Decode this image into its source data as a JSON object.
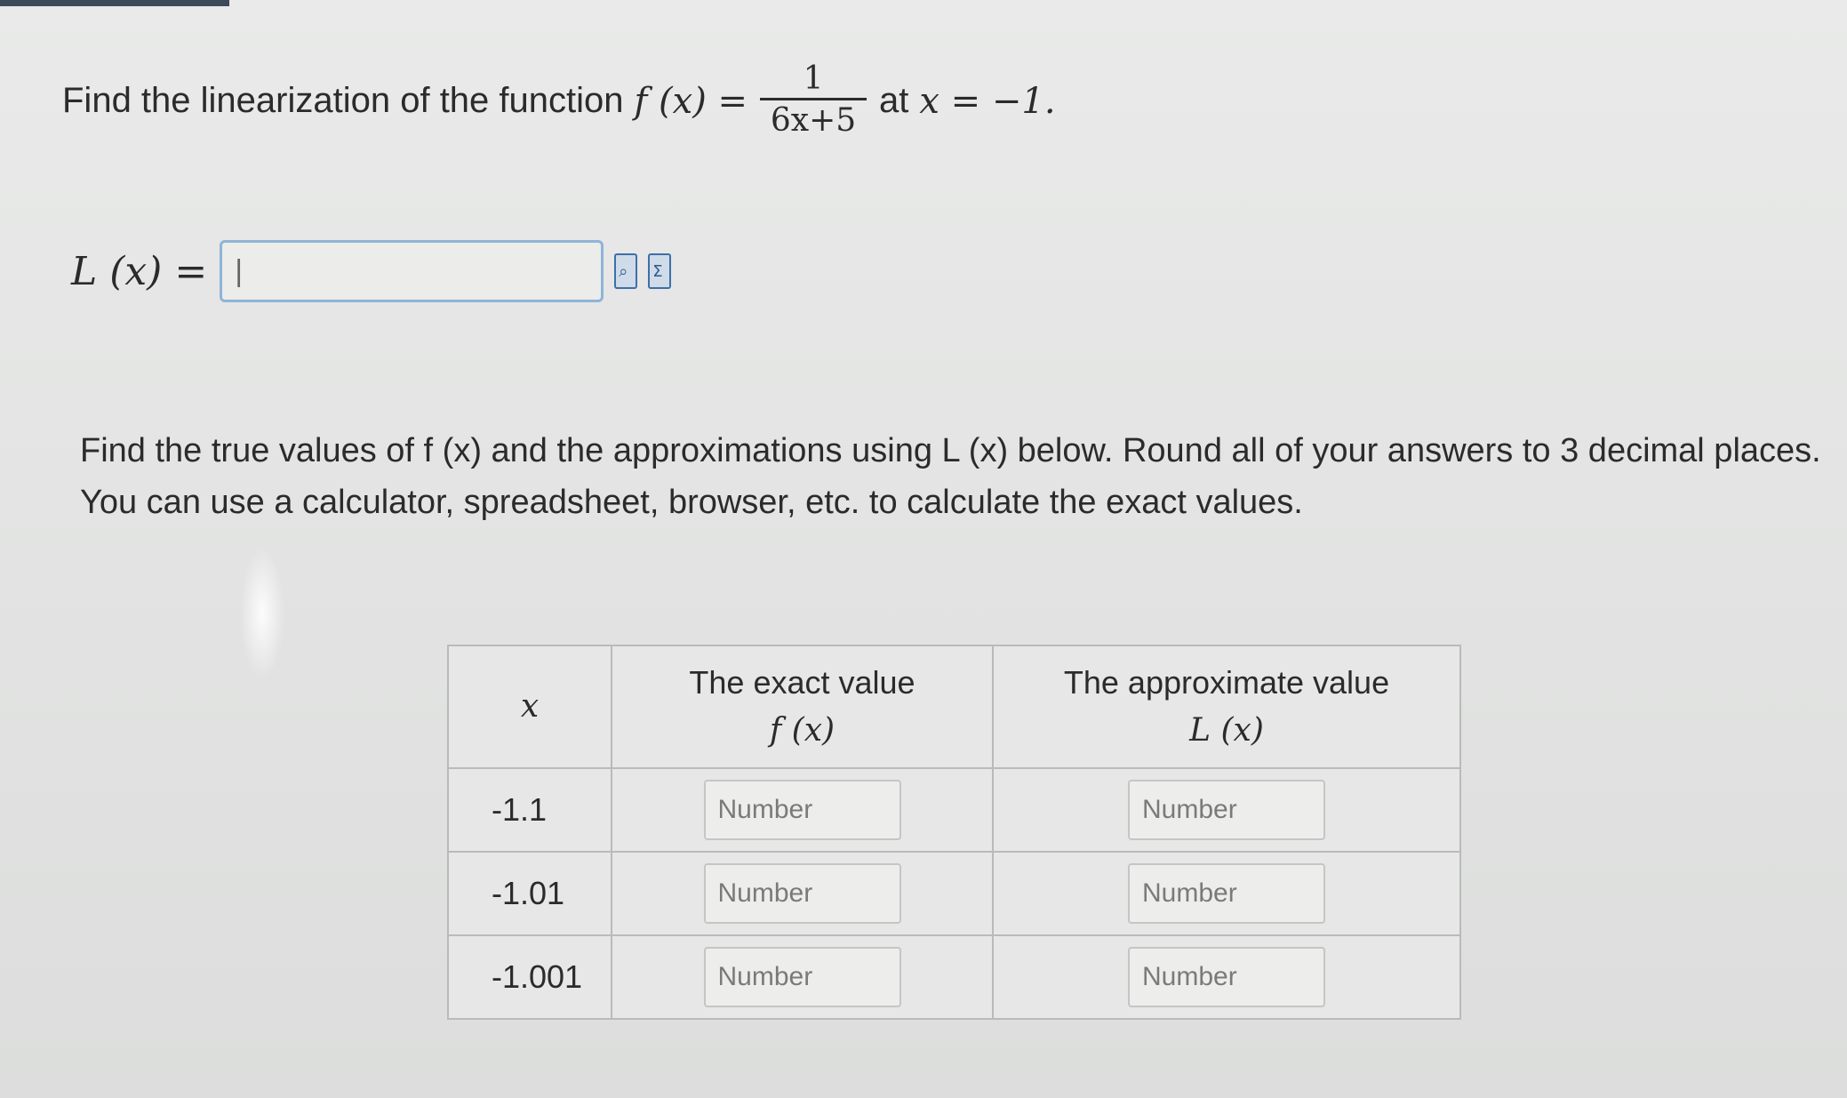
{
  "question": {
    "prefix": "Find the linearization of the function",
    "fx": "f (x) =",
    "numerator": "1",
    "denominator": "6x+5",
    "at": "at",
    "point": "x = −1."
  },
  "linearization": {
    "label": "L (x) =",
    "value": "|"
  },
  "instructions": "Find the true values of f (x) and the approximations using L (x) below. Round all of your answers to 3 decimal places. You can use a calculator, spreadsheet, browser, etc. to calculate the exact values.",
  "table": {
    "headers": [
      {
        "line1": "",
        "line2": "x"
      },
      {
        "line1": "The exact value",
        "line2": "f (x)"
      },
      {
        "line1": "The approximate value",
        "line2": "L (x)"
      }
    ],
    "rows": [
      {
        "x": "-1.1",
        "exact_placeholder": "Number",
        "approx_placeholder": "Number"
      },
      {
        "x": "-1.01",
        "exact_placeholder": "Number",
        "approx_placeholder": "Number"
      },
      {
        "x": "-1.001",
        "exact_placeholder": "Number",
        "approx_placeholder": "Number"
      }
    ]
  },
  "icons": [
    "preview-icon",
    "equation-editor-icon"
  ]
}
